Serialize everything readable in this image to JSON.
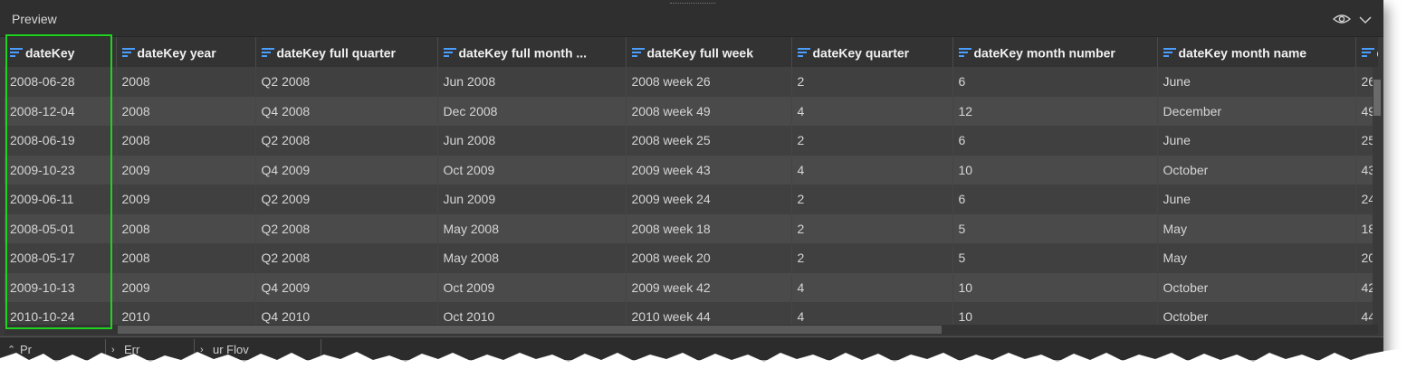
{
  "panel": {
    "title": "Preview",
    "icons": {
      "visibility": "eye-icon",
      "collapse": "chevron-down-icon",
      "sort": "sort-lines-icon"
    }
  },
  "columns": [
    {
      "label": "dateKey",
      "width": 123
    },
    {
      "label": "dateKey year",
      "width": 154
    },
    {
      "label": "dateKey full quarter",
      "width": 201
    },
    {
      "label": "dateKey full month ...",
      "width": 208
    },
    {
      "label": "dateKey full week",
      "width": 183
    },
    {
      "label": "dateKey quarter",
      "width": 178
    },
    {
      "label": "dateKey month number",
      "width": 226
    },
    {
      "label": "dateKey month name",
      "width": 219
    },
    {
      "label": "d",
      "width": 110
    }
  ],
  "rows": [
    [
      "2008-06-28",
      "2008",
      "Q2 2008",
      "Jun 2008",
      "2008 week 26",
      "2",
      "6",
      "June",
      "26"
    ],
    [
      "2008-12-04",
      "2008",
      "Q4 2008",
      "Dec 2008",
      "2008 week 49",
      "4",
      "12",
      "December",
      "49"
    ],
    [
      "2008-06-19",
      "2008",
      "Q2 2008",
      "Jun 2008",
      "2008 week 25",
      "2",
      "6",
      "June",
      "25"
    ],
    [
      "2009-10-23",
      "2009",
      "Q4 2009",
      "Oct 2009",
      "2009 week 43",
      "4",
      "10",
      "October",
      "43"
    ],
    [
      "2009-06-11",
      "2009",
      "Q2 2009",
      "Jun 2009",
      "2009 week 24",
      "2",
      "6",
      "June",
      "24"
    ],
    [
      "2008-05-01",
      "2008",
      "Q2 2008",
      "May 2008",
      "2008 week 18",
      "2",
      "5",
      "May",
      "18"
    ],
    [
      "2008-05-17",
      "2008",
      "Q2 2008",
      "May 2008",
      "2008 week 20",
      "2",
      "5",
      "May",
      "20"
    ],
    [
      "2009-10-13",
      "2009",
      "Q4 2009",
      "Oct 2009",
      "2009 week 42",
      "4",
      "10",
      "October",
      "42"
    ],
    [
      "2010-10-24",
      "2010",
      "Q4 2010",
      "Oct 2010",
      "2010 week 44",
      "4",
      "10",
      "October",
      "44"
    ]
  ],
  "bottom_tabs": [
    {
      "label": "Pr",
      "icon": "chevron-up-icon"
    },
    {
      "label": "Err",
      "icon": "chevron-right-icon"
    },
    {
      "label": "ur Flov",
      "icon": "chevron-right-icon"
    }
  ],
  "colors": {
    "highlight": "#1ed41e",
    "sort_icon": "#4a9eff"
  }
}
